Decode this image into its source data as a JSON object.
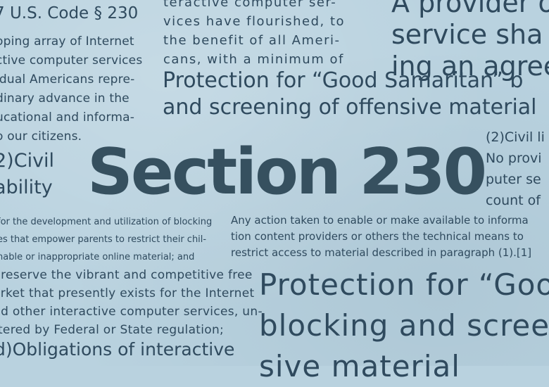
{
  "title": "Section 230",
  "blocks": {
    "code_heading": [
      "7 U.S. Code § 230"
    ],
    "findings": [
      "oping array of Internet",
      "ctive computer services",
      "idual Americans repre-",
      "dinary advance in the",
      "ucational and informa-",
      "o our citizens."
    ],
    "top_center": [
      "teractive computer ser-",
      "vices have flourished, to",
      "the benefit of all Ameri-",
      "cans, with a minimum of"
    ],
    "top_right": [
      "A provider o",
      "service sha",
      "ing an agree"
    ],
    "good_samaritan": [
      "Protection for “Good Samaritan” b",
      "and screening of offensive material"
    ],
    "civil_liability_left": [
      "2)Civil",
      "ability"
    ],
    "civil_liability_right": [
      "(2)Civil li",
      "No provi",
      "puter se",
      "count of"
    ],
    "policy_small": [
      "for the development and utilization of blocking",
      "es that empower parents to restrict their chil-",
      "nable or inappropriate online material; and"
    ],
    "any_action": [
      "Any action taken to enable or make available to informa",
      "tion content providers or others the technical means to",
      "restrict access to material described in paragraph (1).[1]"
    ],
    "preserve": [
      "preserve the vibrant and competitive free",
      "arket that presently exists for the Internet",
      "nd other interactive computer services, un-",
      "ttered by Federal or State regulation;"
    ],
    "blocking_large": [
      "Protection for “Goo",
      "blocking and scree",
      "sive material"
    ],
    "obligations": [
      "d)Obligations of interactive"
    ]
  },
  "colors": {
    "background": "#b9d2df",
    "text": "#2f4a5e",
    "title": "#36505f"
  }
}
